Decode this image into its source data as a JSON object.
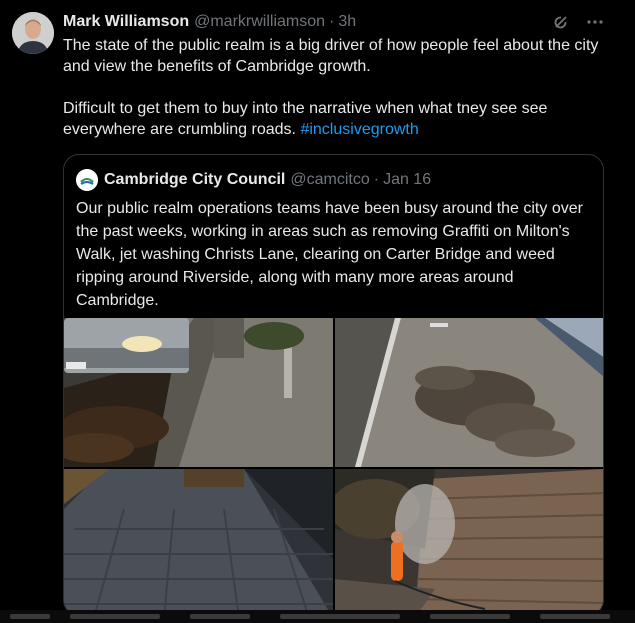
{
  "tweet": {
    "author_name": "Mark Williamson",
    "author_handle": "@markrwilliamson",
    "separator": "·",
    "time": "3h",
    "text_line1": "The state of the public realm is a big driver of how people feel about the city and view the benefits of  Cambridge growth.",
    "text_line2": "Difficult to get them to buy into the narrative when what tney see see everywhere are crumbling roads.",
    "hashtag": "#inclusivegrowth",
    "icons": [
      "grok-icon",
      "more-icon"
    ]
  },
  "quote": {
    "author_name": "Cambridge City Council",
    "author_handle": "@camcitco",
    "separator": "·",
    "date": "Jan 16",
    "text": "Our public realm operations teams have been busy around the city over the past  weeks, working in areas such as removing Graffiti on Milton's Walk, jet washing Christs Lane, clearing on Carter Bridge and weed ripping around Riverside, along with many more areas around Cambridge.",
    "images": [
      "photo-van-gutter-leaves",
      "photo-pavement-debris",
      "photo-paved-alley",
      "photo-jet-washing-wall"
    ]
  },
  "colors": {
    "background": "#000000",
    "text": "#e7e9ea",
    "secondary": "#71767b",
    "link": "#1d9bf0",
    "border": "#2f3336"
  }
}
